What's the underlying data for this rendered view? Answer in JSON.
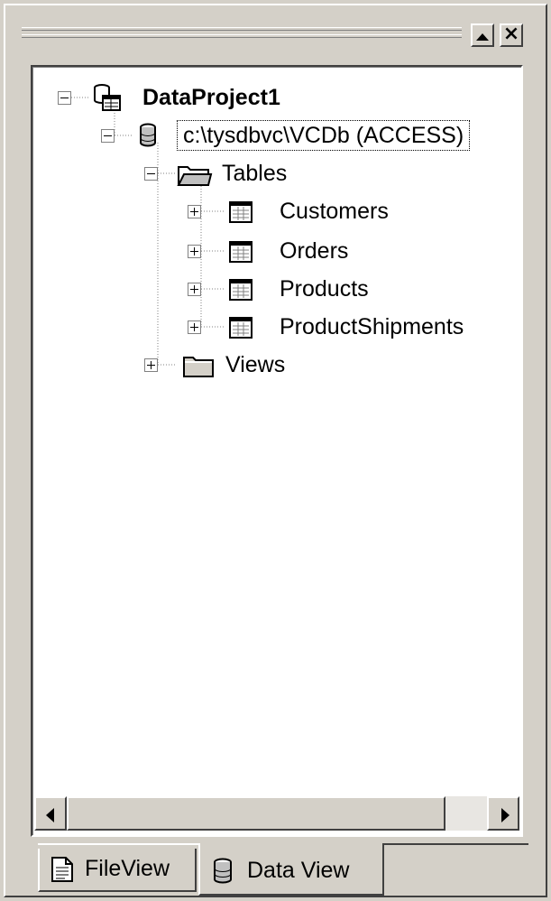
{
  "window": {
    "maximize_icon": "triangle-up-icon",
    "close_label": "×"
  },
  "tree": {
    "project": {
      "label": "DataProject1",
      "icon": "data-project-icon"
    },
    "connection": {
      "label": "c:\\tysdbvc\\VCDb (ACCESS)",
      "icon": "database-icon"
    },
    "tables_folder": {
      "label": "Tables",
      "icon": "open-folder-icon"
    },
    "tables": [
      {
        "label": "Customers",
        "icon": "table-icon"
      },
      {
        "label": "Orders",
        "icon": "table-icon"
      },
      {
        "label": "Products",
        "icon": "table-icon"
      },
      {
        "label": "ProductShipments",
        "icon": "table-icon"
      }
    ],
    "views_folder": {
      "label": "Views",
      "icon": "closed-folder-icon"
    }
  },
  "tabs": [
    {
      "label": "FileView",
      "icon": "document-icon",
      "active": false
    },
    {
      "label": "Data View",
      "icon": "database-icon",
      "active": true
    }
  ],
  "colors": {
    "face": "#d4d0c8",
    "window": "#ffffff",
    "shadow": "#808080",
    "dark": "#404040"
  }
}
